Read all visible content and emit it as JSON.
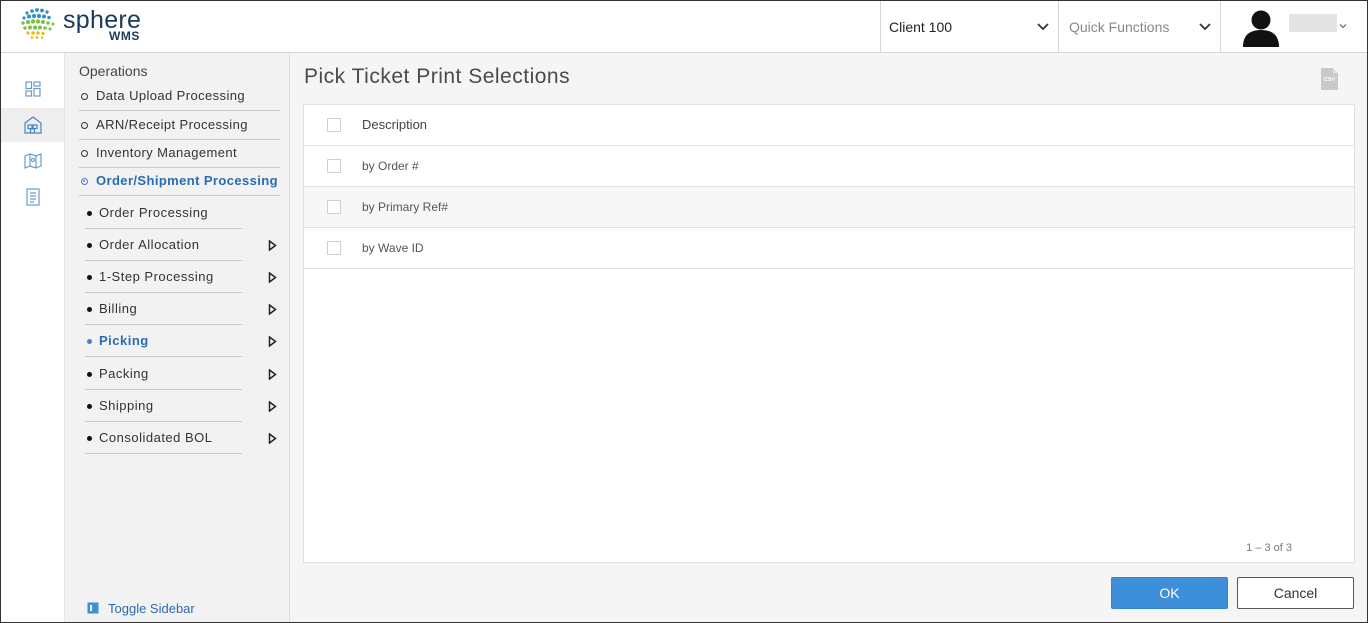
{
  "app": {
    "logo_word": "sphere",
    "logo_sub": "WMS"
  },
  "header": {
    "client_select": "Client 100",
    "quick_functions": "Quick Functions"
  },
  "sidebar": {
    "title": "Operations",
    "level1": [
      {
        "label": "Data Upload Processing"
      },
      {
        "label": "ARN/Receipt Processing"
      },
      {
        "label": "Inventory Management"
      },
      {
        "label": "Order/Shipment Processing"
      }
    ],
    "level2": [
      {
        "label": "Order Processing"
      },
      {
        "label": "Order Allocation"
      },
      {
        "label": "1-Step Processing"
      },
      {
        "label": "Billing"
      },
      {
        "label": "Picking"
      },
      {
        "label": "Packing"
      },
      {
        "label": "Shipping"
      },
      {
        "label": "Consolidated BOL"
      }
    ],
    "toggle_label": "Toggle Sidebar"
  },
  "main": {
    "title": "Pick Ticket Print Selections",
    "export_icon": "csv-icon",
    "grid": {
      "header": "Description",
      "rows": [
        {
          "description": "by Order #"
        },
        {
          "description": "by Primary Ref#"
        },
        {
          "description": "by Wave ID"
        }
      ],
      "pager": "1 – 3 of 3"
    },
    "ok_label": "OK",
    "cancel_label": "Cancel"
  },
  "colors": {
    "accent": "#3d8fd9",
    "active_link": "#2b6cb0"
  }
}
